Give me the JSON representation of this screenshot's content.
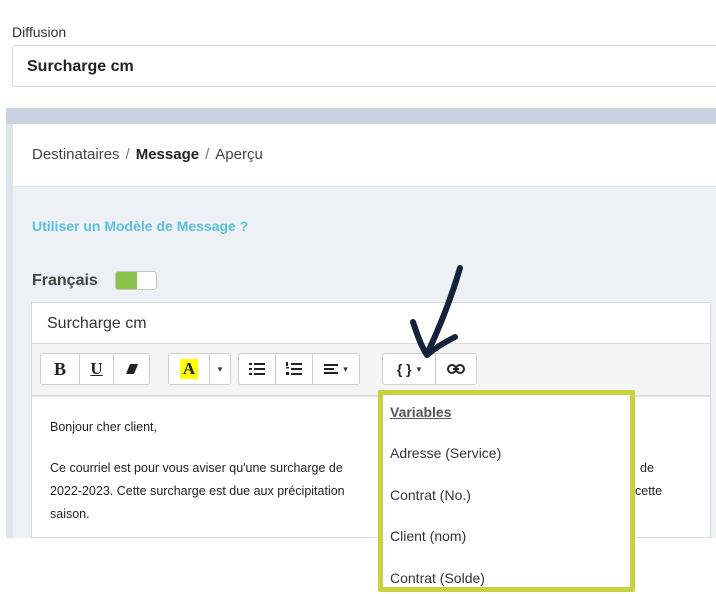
{
  "diffusion": {
    "label": "Diffusion",
    "value": "Surcharge cm"
  },
  "breadcrumb": {
    "step1": "Destinataires",
    "sep": "/",
    "step2": "Message",
    "step3": "Aperçu"
  },
  "template_link": "Utiliser un Modèle de Message ?",
  "language": {
    "label": "Français",
    "toggle_on": true,
    "toggle_color": "#8bc34a"
  },
  "subject": {
    "value": "Surcharge cm"
  },
  "toolbar": {
    "bold": "B",
    "underline": "U",
    "highlight": "A",
    "variables": "{ }",
    "caret": "▾"
  },
  "editor": {
    "greeting": "Bonjour cher client,",
    "line1_left": "Ce courriel est pour vous aviser qu'une surcharge de",
    "line1_right": "de",
    "line2_left": "2022-2023. Cette surcharge est due aux précipitation",
    "line2_right": "cette",
    "line3": "saison."
  },
  "variables_menu": {
    "title": "Variables",
    "items": [
      "Adresse (Service)",
      "Contrat (No.)",
      "Client (nom)",
      "Contrat (Solde)"
    ],
    "highlight_color": "#c8d23a"
  }
}
